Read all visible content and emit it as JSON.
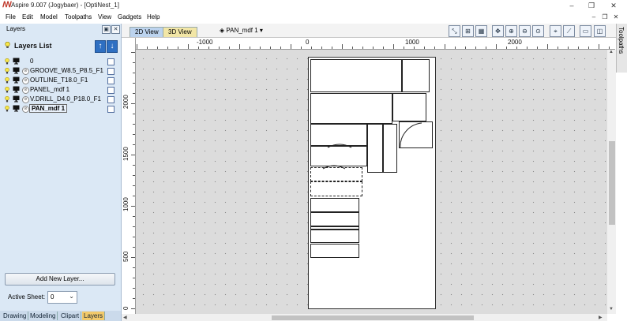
{
  "window": {
    "title": "Aspire 9.007 (Jogybaer) - [OptiNest_1]",
    "controls": {
      "minimize": "–",
      "restore": "❐",
      "close": "✕"
    }
  },
  "menubar": {
    "items": [
      "File",
      "Edit",
      "Model",
      "Toolpaths",
      "View",
      "Gadgets",
      "Help"
    ],
    "mdi": {
      "minimize": "–",
      "restore": "❐",
      "close": "✕"
    }
  },
  "layers_panel": {
    "header": "Layers",
    "list_title": "Layers List",
    "layers": [
      {
        "name": "0",
        "selected": false
      },
      {
        "name": "GROOVE_W8.5_P8.5_F1",
        "selected": false
      },
      {
        "name": "OUTLINE_T18.0_F1",
        "selected": false
      },
      {
        "name": "PANEL_mdf 1",
        "selected": false
      },
      {
        "name": "V.DRILL_D4.0_P18.0_F1",
        "selected": false
      },
      {
        "name": "PAN_mdf 1",
        "selected": true
      }
    ],
    "add_button": "Add New Layer...",
    "active_sheet_label": "Active Sheet:",
    "active_sheet_value": "0"
  },
  "bottom_tabs": {
    "items": [
      "Drawing",
      "Modeling",
      "Clipart",
      "Layers"
    ],
    "active": "Layers"
  },
  "view_tabs": {
    "tab_2d": "2D View",
    "tab_3d": "3D View",
    "sheet_dropdown": "PAN_mdf 1",
    "active": "2D View"
  },
  "right_strip": {
    "label": "Toolpaths"
  },
  "rulers": {
    "horizontal_labels": [
      "-1000",
      "0",
      "1000",
      "2000"
    ],
    "vertical_labels": [
      "2000",
      "1500",
      "1000",
      "500",
      "0"
    ]
  },
  "colors": {
    "panel_bg": "#dbe8f5",
    "canvas_bg": "#dcdcdc",
    "tab_2d": "#bcd3ee",
    "tab_3d": "#f2e6a6",
    "active_bottom_tab": "#f2c96a",
    "arrow_button": "#2e6fc2"
  },
  "icons": {
    "app": "aspire-logo-icon",
    "bulb": "lightbulb-icon",
    "monitor": "monitor-icon",
    "move_up": "arrow-up-icon",
    "move_down": "arrow-down-icon"
  }
}
